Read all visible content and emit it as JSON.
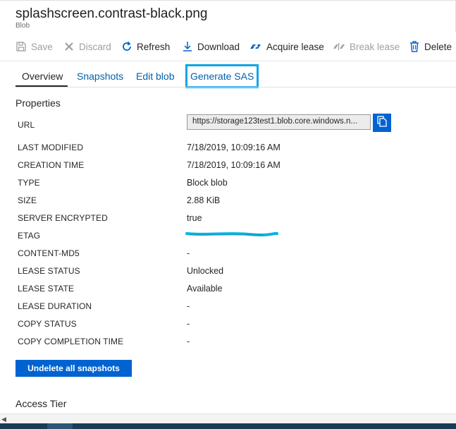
{
  "header": {
    "title": "splashscreen.contrast-black.png",
    "subtitle": "Blob"
  },
  "toolbar": {
    "save": "Save",
    "discard": "Discard",
    "refresh": "Refresh",
    "download": "Download",
    "acquire_lease": "Acquire lease",
    "break_lease": "Break lease",
    "delete": "Delete"
  },
  "tabs": {
    "overview": "Overview",
    "snapshots": "Snapshots",
    "edit_blob": "Edit blob",
    "generate_sas": "Generate SAS"
  },
  "properties": {
    "section_title": "Properties",
    "url_label": "URL",
    "url_value": "https://storage123test1.blob.core.windows.n...",
    "rows": [
      {
        "label": "LAST MODIFIED",
        "value": "7/18/2019, 10:09:16 AM"
      },
      {
        "label": "CREATION TIME",
        "value": "7/18/2019, 10:09:16 AM"
      },
      {
        "label": "TYPE",
        "value": "Block blob"
      },
      {
        "label": "SIZE",
        "value": "2.88 KiB"
      },
      {
        "label": "SERVER ENCRYPTED",
        "value": "true"
      },
      {
        "label": "ETAG",
        "value": ""
      },
      {
        "label": "CONTENT-MD5",
        "value": "-"
      },
      {
        "label": "LEASE STATUS",
        "value": "Unlocked"
      },
      {
        "label": "LEASE STATE",
        "value": "Available"
      },
      {
        "label": "LEASE DURATION",
        "value": "-"
      },
      {
        "label": "COPY STATUS",
        "value": "-"
      },
      {
        "label": "COPY COMPLETION TIME",
        "value": "-"
      }
    ]
  },
  "actions": {
    "undelete": "Undelete all snapshots"
  },
  "access_tier": {
    "title": "Access Tier"
  },
  "colors": {
    "accent": "#0063d1",
    "link": "#0062ad",
    "highlight": "#0ea5e9",
    "redaction": "#00b4e6"
  }
}
